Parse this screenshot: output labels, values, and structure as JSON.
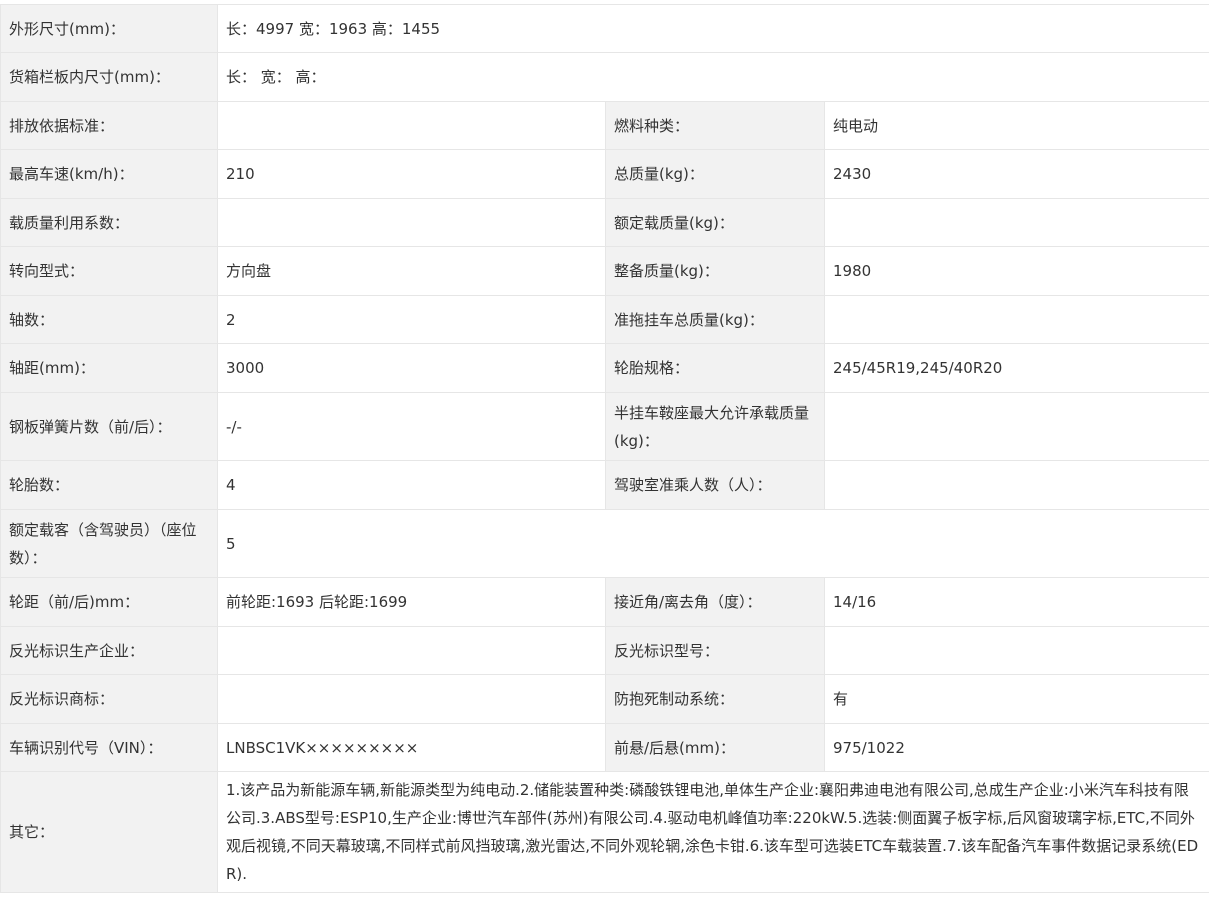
{
  "rows": [
    {
      "type": "wide",
      "label": "外形尺寸(mm)：",
      "value": "长：4997 宽：1963 高：1455"
    },
    {
      "type": "wide",
      "label": "货箱栏板内尺寸(mm)：",
      "value": "长： 宽： 高："
    },
    {
      "type": "pair",
      "label1": "排放依据标准：",
      "value1": "",
      "label2": "燃料种类：",
      "value2": "纯电动"
    },
    {
      "type": "pair",
      "label1": "最高车速(km/h)：",
      "value1": "210",
      "label2": "总质量(kg)：",
      "value2": "2430"
    },
    {
      "type": "pair",
      "label1": "载质量利用系数：",
      "value1": "",
      "label2": "额定载质量(kg)：",
      "value2": ""
    },
    {
      "type": "pair",
      "label1": "转向型式：",
      "value1": "方向盘",
      "label2": "整备质量(kg)：",
      "value2": "1980"
    },
    {
      "type": "pair",
      "label1": "轴数：",
      "value1": "2",
      "label2": "准拖挂车总质量(kg)：",
      "value2": ""
    },
    {
      "type": "pair",
      "label1": "轴距(mm)：",
      "value1": "3000",
      "label2": "轮胎规格：",
      "value2": "245/45R19,245/40R20"
    },
    {
      "type": "pair",
      "label1": "钢板弹簧片数（前/后）：",
      "value1": "-/-",
      "label2": "半挂车鞍座最大允许承载质量(kg)：",
      "value2": ""
    },
    {
      "type": "pair",
      "label1": "轮胎数：",
      "value1": "4",
      "label2": "驾驶室准乘人数（人）：",
      "value2": ""
    },
    {
      "type": "wide",
      "label": "额定载客（含驾驶员）（座位数）：",
      "value": "5"
    },
    {
      "type": "pair",
      "label1": "轮距（前/后)mm：",
      "value1": "前轮距:1693 后轮距:1699",
      "label2": "接近角/离去角（度）：",
      "value2": "14/16"
    },
    {
      "type": "pair",
      "label1": "反光标识生产企业：",
      "value1": "",
      "label2": "反光标识型号：",
      "value2": ""
    },
    {
      "type": "pair",
      "label1": "反光标识商标：",
      "value1": "",
      "label2": "防抱死制动系统：",
      "value2": "有"
    },
    {
      "type": "pair",
      "label1": "车辆识别代号（VIN）：",
      "value1": "LNBSC1VK×××××××××",
      "label2": "前悬/后悬(mm)：",
      "value2": "975/1022"
    },
    {
      "type": "wide",
      "label": "其它：",
      "value": "1.该产品为新能源车辆,新能源类型为纯电动.2.储能装置种类:磷酸铁锂电池,单体生产企业:襄阳弗迪电池有限公司,总成生产企业:小米汽车科技有限公司.3.ABS型号:ESP10,生产企业:博世汽车部件(苏州)有限公司.4.驱动电机峰值功率:220kW.5.选装:侧面翼子板字标,后风窗玻璃字标,ETC,不同外观后视镜,不同天幕玻璃,不同样式前风挡玻璃,激光雷达,不同外观轮辋,涂色卡钳.6.该车型可选装ETC车载装置.7.该车配备汽车事件数据记录系统(EDR)."
    }
  ]
}
